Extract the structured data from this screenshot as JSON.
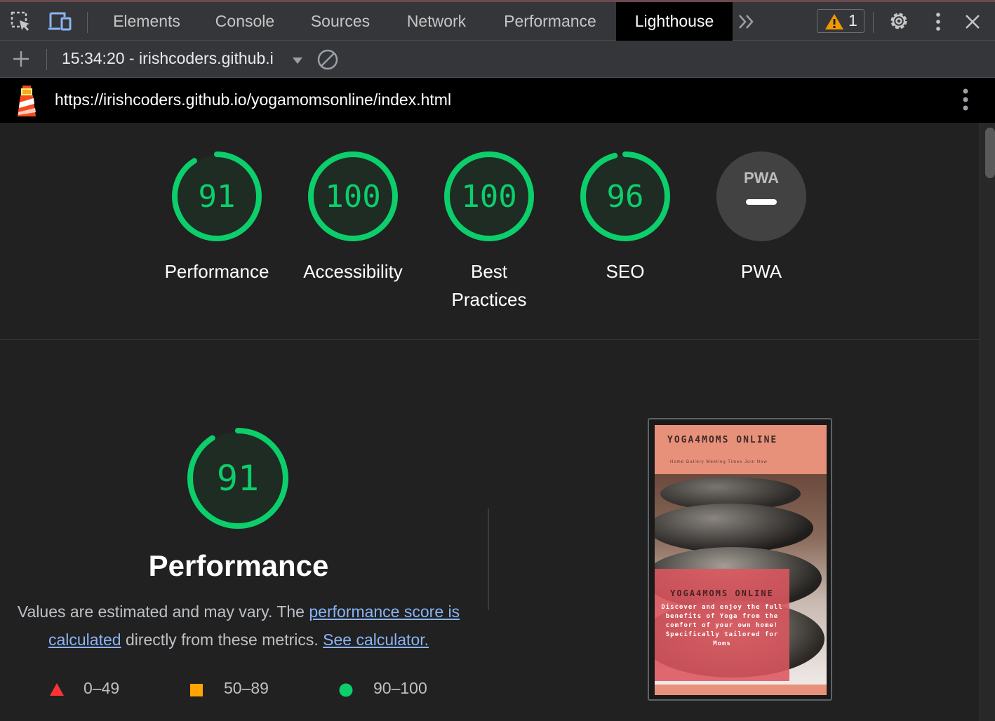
{
  "devtools": {
    "tabs": [
      {
        "label": "Elements"
      },
      {
        "label": "Console"
      },
      {
        "label": "Sources"
      },
      {
        "label": "Network"
      },
      {
        "label": "Performance"
      },
      {
        "label": "Lighthouse",
        "active": true
      }
    ],
    "warning_count": "1",
    "icons": [
      "inspect-element-icon",
      "device-toolbar-icon",
      "more-tabs-icon",
      "warning-icon",
      "gear-icon",
      "kebab-menu-icon",
      "close-icon"
    ]
  },
  "lighthouse_toolbar": {
    "report_label": "15:34:20 - irishcoders.github.i",
    "icons": [
      "plus-icon",
      "dropdown-arrow-icon",
      "clear-icon"
    ]
  },
  "url_bar": {
    "url": "https://irishcoders.github.io/yogamomsonline/index.html"
  },
  "gauges": [
    {
      "label": "Performance",
      "score": "91",
      "fraction": 0.91
    },
    {
      "label": "Accessibility",
      "score": "100",
      "fraction": 1.0
    },
    {
      "label": "Best Practices",
      "score": "100",
      "fraction": 1.0
    },
    {
      "label": "SEO",
      "score": "96",
      "fraction": 0.96
    },
    {
      "label": "PWA",
      "badge": "PWA"
    }
  ],
  "performance": {
    "score": "91",
    "fraction": 0.91,
    "title": "Performance",
    "desc_before": "Values are estimated and may vary. The ",
    "link_score": "performance score is calculated",
    "desc_middle": " directly from these metrics. ",
    "link_calculator": "See calculator."
  },
  "legend": [
    {
      "range": "0–49",
      "shape": "triangle",
      "color": "#ff3333"
    },
    {
      "range": "50–89",
      "shape": "square",
      "color": "#ffa400"
    },
    {
      "range": "90–100",
      "shape": "circle",
      "color": "#0cce6b"
    }
  ],
  "colors": {
    "pass": "#0cce6b",
    "pass_bg": "#1e2c23",
    "neutral_gauge": "#424242"
  },
  "thumbnail": {
    "brand": "YOGA4MOMS ONLINE",
    "nav": "Home  Gallery  Meeting Times  Join Now",
    "card_title": "YOGA4MOMS ONLINE",
    "card_text": "Discover and enjoy the full benefits of Yoga from the comfort of your own home! Specifically tailored for Moms"
  }
}
